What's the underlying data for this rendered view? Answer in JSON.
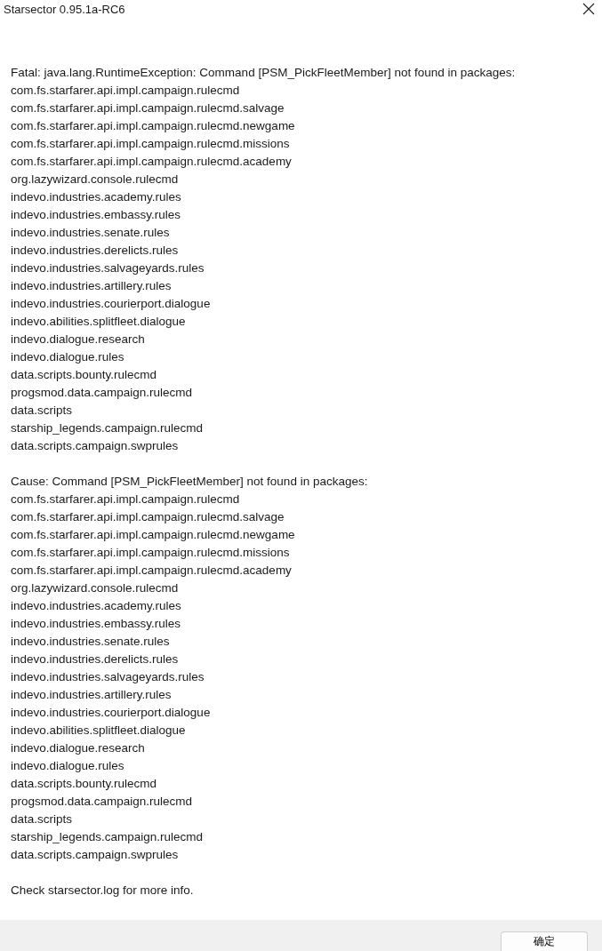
{
  "window": {
    "title": "Starsector 0.95.1a-RC6"
  },
  "fatal": {
    "heading": "Fatal: java.lang.RuntimeException: Command [PSM_PickFleetMember] not found in packages:",
    "packages": [
      "com.fs.starfarer.api.impl.campaign.rulecmd",
      "com.fs.starfarer.api.impl.campaign.rulecmd.salvage",
      "com.fs.starfarer.api.impl.campaign.rulecmd.newgame",
      "com.fs.starfarer.api.impl.campaign.rulecmd.missions",
      "com.fs.starfarer.api.impl.campaign.rulecmd.academy",
      "org.lazywizard.console.rulecmd",
      "indevo.industries.academy.rules",
      "indevo.industries.embassy.rules",
      "indevo.industries.senate.rules",
      "indevo.industries.derelicts.rules",
      "indevo.industries.salvageyards.rules",
      "indevo.industries.artillery.rules",
      "indevo.industries.courierport.dialogue",
      "indevo.abilities.splitfleet.dialogue",
      "indevo.dialogue.research",
      "indevo.dialogue.rules",
      "data.scripts.bounty.rulecmd",
      "progsmod.data.campaign.rulecmd",
      "data.scripts",
      "starship_legends.campaign.rulecmd",
      "data.scripts.campaign.swprules"
    ]
  },
  "cause": {
    "heading": "Cause: Command [PSM_PickFleetMember] not found in packages:",
    "packages": [
      "com.fs.starfarer.api.impl.campaign.rulecmd",
      "com.fs.starfarer.api.impl.campaign.rulecmd.salvage",
      "com.fs.starfarer.api.impl.campaign.rulecmd.newgame",
      "com.fs.starfarer.api.impl.campaign.rulecmd.missions",
      "com.fs.starfarer.api.impl.campaign.rulecmd.academy",
      "org.lazywizard.console.rulecmd",
      "indevo.industries.academy.rules",
      "indevo.industries.embassy.rules",
      "indevo.industries.senate.rules",
      "indevo.industries.derelicts.rules",
      "indevo.industries.salvageyards.rules",
      "indevo.industries.artillery.rules",
      "indevo.industries.courierport.dialogue",
      "indevo.abilities.splitfleet.dialogue",
      "indevo.dialogue.research",
      "indevo.dialogue.rules",
      "data.scripts.bounty.rulecmd",
      "progsmod.data.campaign.rulecmd",
      "data.scripts",
      "starship_legends.campaign.rulecmd",
      "data.scripts.campaign.swprules"
    ]
  },
  "footer_note": "Check starsector.log for more info.",
  "buttons": [
    "确定"
  ]
}
